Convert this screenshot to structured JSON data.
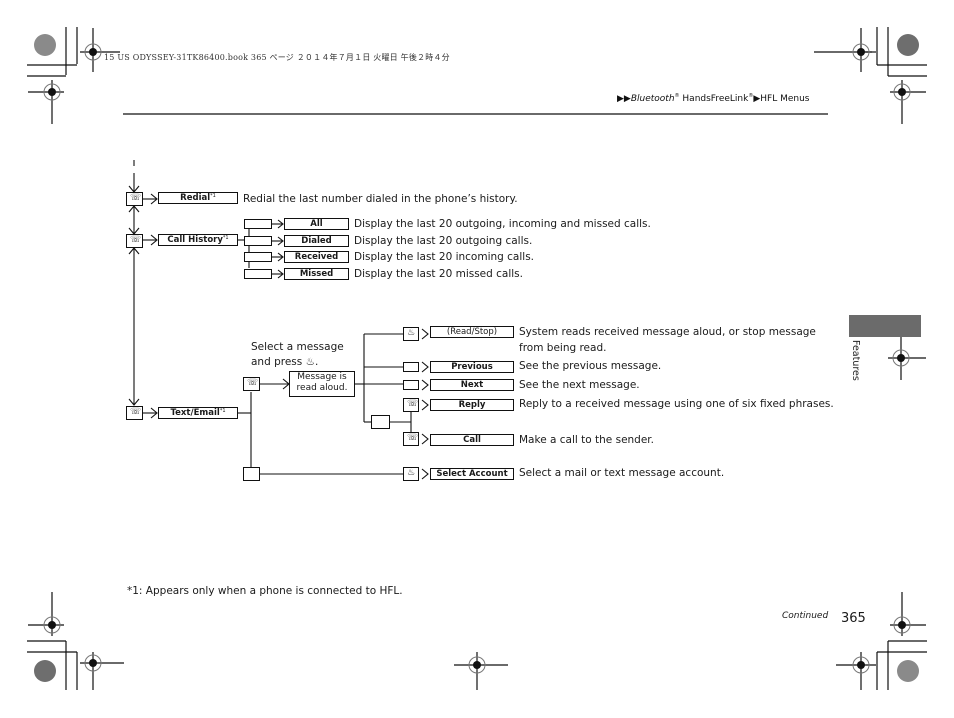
{
  "print_header": "15 US ODYSSEY-31TK86400.book  365 ページ  ２０１４年７月１日  火曜日  午後２時４分",
  "breadcrumb": {
    "part1": "Bluetooth",
    "reg1": "®",
    "part2": " HandsFreeLink",
    "reg2": "®",
    "part3": "HFL Menus"
  },
  "side_tab": {
    "label": "Features"
  },
  "menu": {
    "redial": {
      "label": "Redial",
      "footnote": "*1",
      "desc": "Redial the last number dialed in the phone’s history."
    },
    "call_history": {
      "label": "Call History",
      "footnote": "*1",
      "items": [
        {
          "label": "All",
          "desc": "Display the last 20 outgoing, incoming and missed calls."
        },
        {
          "label": "Dialed",
          "desc": "Display the last 20 outgoing calls."
        },
        {
          "label": "Received",
          "desc": "Display the last 20 incoming calls."
        },
        {
          "label": "Missed",
          "desc": "Display the last 20 missed calls."
        }
      ]
    },
    "text_email": {
      "label": "Text/Email",
      "footnote": "*1",
      "instruction_line1": "Select a message",
      "instruction_line2": "and press",
      "instruction_end": ".",
      "message_box_line1": "Message is",
      "message_box_line2": "read aloud.",
      "items": [
        {
          "label": "(Read/Stop)",
          "desc_line1": "System reads received message aloud, or stop message",
          "desc_line2": "from being read."
        },
        {
          "label": "Previous",
          "desc_line1": "See the previous message."
        },
        {
          "label": "Next",
          "desc_line1": "See the next message."
        },
        {
          "label": "Reply",
          "desc_line1": "Reply to a received message using one of six fixed phrases."
        },
        {
          "label": "Call",
          "desc_line1": "Make a call to the sender."
        },
        {
          "label": "Select Account",
          "desc_line1": "Select a mail or text message account."
        }
      ]
    }
  },
  "footnote": "*1: Appears only when a phone is connected to HFL.",
  "footer": {
    "continued": "Continued",
    "page_number": "365"
  }
}
